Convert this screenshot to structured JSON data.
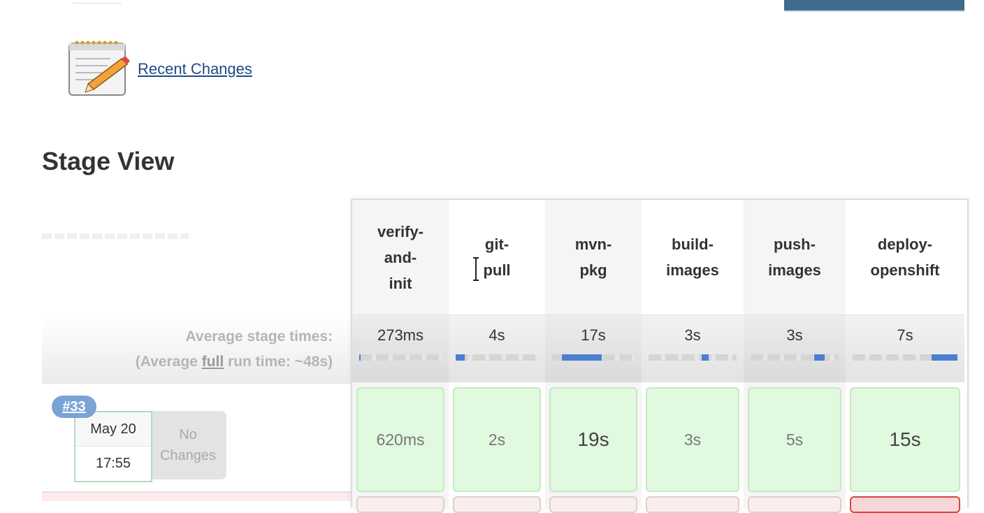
{
  "header": {
    "recent_changes_label": "Recent Changes"
  },
  "stage_view": {
    "title": "Stage View",
    "average_label": "Average stage times:",
    "average_full_prefix": "(Average ",
    "average_full_word": "full",
    "average_full_suffix": " run time: ~48s)",
    "stages": [
      {
        "name": "verify-\nand-\ninit",
        "avg": "273ms",
        "avg_fill": [
          0.0,
          0.01
        ],
        "run_time": "620ms"
      },
      {
        "name": "git-\npull",
        "avg": "4s",
        "avg_fill": [
          0.0,
          0.11
        ],
        "run_time": "2s"
      },
      {
        "name": "mvn-\npkg",
        "avg": "17s",
        "avg_fill": [
          0.12,
          0.6
        ],
        "run_time": "19s"
      },
      {
        "name": "build-\nimages",
        "avg": "3s",
        "avg_fill": [
          0.6,
          0.68
        ],
        "run_time": "3s"
      },
      {
        "name": "push-\nimages",
        "avg": "3s",
        "avg_fill": [
          0.72,
          0.84
        ],
        "run_time": "5s"
      },
      {
        "name": "deploy-\nopenshift",
        "avg": "7s",
        "avg_fill": [
          0.75,
          1.0
        ],
        "run_time": "15s"
      }
    ],
    "run": {
      "number": "#33",
      "date": "May 20",
      "time": "17:55",
      "changes": "No\nChanges"
    }
  },
  "colors": {
    "success_cell": "#e1f9df",
    "progress_fill": "#4a7fd1",
    "badge": "#7aa3d6"
  }
}
